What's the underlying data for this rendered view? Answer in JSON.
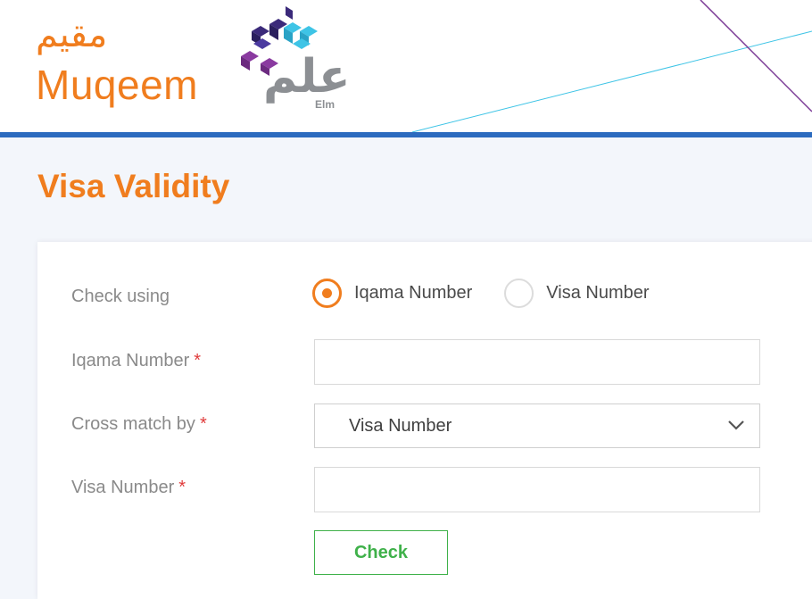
{
  "header": {
    "logo_muqeem_arabic": "مقيم",
    "logo_muqeem_latin": "Muqeem",
    "logo_elm_arabic": "علم",
    "logo_elm_latin": "Elm"
  },
  "page": {
    "title": "Visa Validity"
  },
  "form": {
    "check_using_label": "Check using",
    "radio_options": [
      {
        "label": "Iqama Number",
        "selected": true
      },
      {
        "label": "Visa Number",
        "selected": false
      }
    ],
    "iqama_label": "Iqama Number",
    "iqama_value": "",
    "cross_match_label": "Cross match by",
    "cross_match_value": "Visa Number",
    "visa_label": "Visa Number",
    "visa_value": "",
    "required_mark": "*",
    "submit_label": "Check"
  },
  "colors": {
    "brand_orange": "#f07d1e",
    "header_bar_blue": "#2c6bbf",
    "check_green": "#3fb14a",
    "required_red": "#e03b3b"
  }
}
